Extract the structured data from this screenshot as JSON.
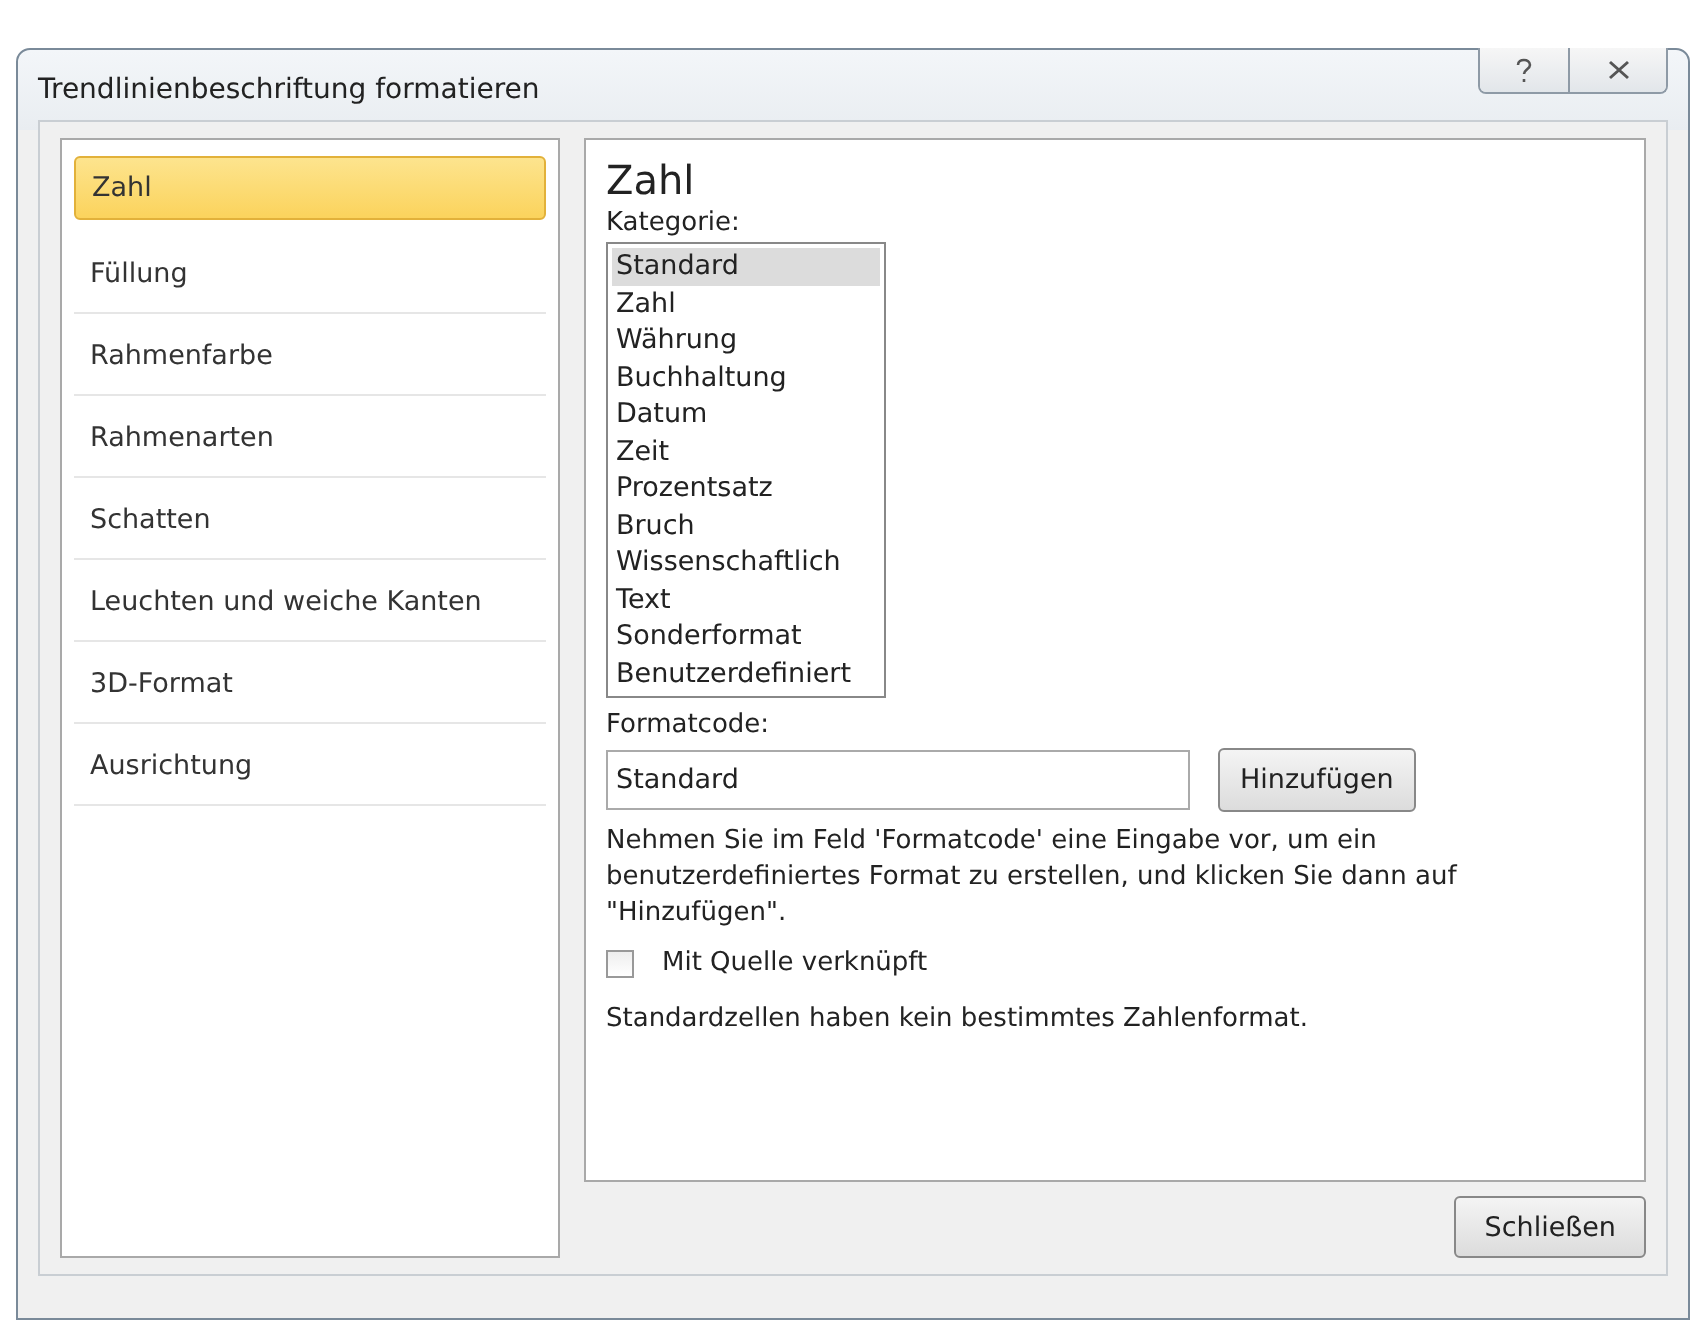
{
  "window": {
    "title": "Trendlinienbeschriftung formatieren"
  },
  "sidebar": {
    "items": [
      {
        "label": "Zahl",
        "selected": true
      },
      {
        "label": "Füllung",
        "selected": false
      },
      {
        "label": "Rahmenfarbe",
        "selected": false
      },
      {
        "label": "Rahmenarten",
        "selected": false
      },
      {
        "label": "Schatten",
        "selected": false
      },
      {
        "label": "Leuchten und weiche Kanten",
        "selected": false
      },
      {
        "label": "3D-Format",
        "selected": false
      },
      {
        "label": "Ausrichtung",
        "selected": false
      }
    ]
  },
  "panel": {
    "heading": "Zahl",
    "category_label": "Kategorie:",
    "categories": [
      {
        "label": "Standard",
        "selected": true
      },
      {
        "label": "Zahl",
        "selected": false
      },
      {
        "label": "Währung",
        "selected": false
      },
      {
        "label": "Buchhaltung",
        "selected": false
      },
      {
        "label": "Datum",
        "selected": false
      },
      {
        "label": "Zeit",
        "selected": false
      },
      {
        "label": "Prozentsatz",
        "selected": false
      },
      {
        "label": "Bruch",
        "selected": false
      },
      {
        "label": "Wissenschaftlich",
        "selected": false
      },
      {
        "label": "Text",
        "selected": false
      },
      {
        "label": "Sonderformat",
        "selected": false
      },
      {
        "label": "Benutzerdefiniert",
        "selected": false
      }
    ],
    "format_code_label": "Formatcode:",
    "format_code_value": "Standard",
    "add_button": "Hinzufügen",
    "hint": "Nehmen Sie im Feld 'Formatcode' eine Eingabe vor, um ein benutzerdefiniertes Format zu erstellen, und klicken Sie dann auf \"Hinzufügen\".",
    "linked_checkbox": {
      "label": "Mit Quelle verknüpft",
      "checked": false
    },
    "description": "Standardzellen haben kein bestimmtes Zahlenformat."
  },
  "buttons": [
    {
      "label": "Schließen"
    }
  ]
}
